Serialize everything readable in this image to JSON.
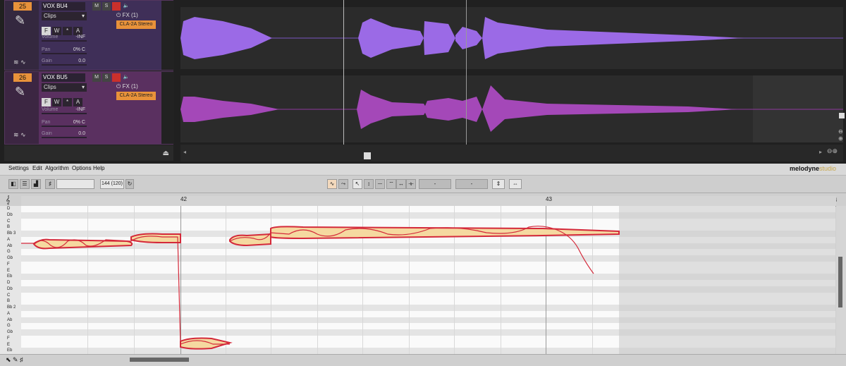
{
  "daw": {
    "tracks": [
      {
        "number": "25",
        "name": "VOX BU4",
        "buttons": [
          "M",
          "S"
        ],
        "clips_label": "Clips",
        "modes": [
          "F",
          "W",
          "*",
          "A"
        ],
        "volume_label": "Volume",
        "volume_value": "-INF",
        "pan_label": "Pan",
        "pan_value": "0% C",
        "gain_label": "Gain",
        "gain_value": "0.0",
        "fx_label": "FX (1)",
        "fx_plugin": "CLA-2A Stereo",
        "waveform_color": "#9b6ae6"
      },
      {
        "number": "26",
        "name": "VOX BU5",
        "buttons": [
          "M",
          "S"
        ],
        "clips_label": "Clips",
        "modes": [
          "F",
          "W",
          "*",
          "A"
        ],
        "volume_label": "Volume",
        "volume_value": "-INF",
        "pan_label": "Pan",
        "pan_value": "0% C",
        "gain_label": "Gain",
        "gain_value": "0.0",
        "fx_label": "FX (1)",
        "fx_plugin": "CLA-2A Stereo",
        "waveform_color": "#a448b8"
      }
    ]
  },
  "melodyne": {
    "menu": [
      "Settings",
      "Edit",
      "Algorithm",
      "Options",
      "Help"
    ],
    "logo": "melodyne",
    "logo_suffix": "studio",
    "tempo": "144 (120)",
    "field_dash_1": "-",
    "field_dash_2": "-",
    "bar_labels": [
      "42",
      "43"
    ],
    "pitch_keys": [
      "D",
      "Db",
      "C",
      "B",
      "Bb 3",
      "A",
      "Ab",
      "G",
      "Gb",
      "F",
      "E",
      "Eb",
      "D",
      "Db",
      "C",
      "B",
      "Bb 2",
      "A",
      "Ab",
      "G",
      "Gb",
      "F",
      "E",
      "Eb"
    ],
    "accent_color": "#e8923a",
    "blob_color": "#f5d9a0",
    "blob_outline": "#d4293a"
  }
}
